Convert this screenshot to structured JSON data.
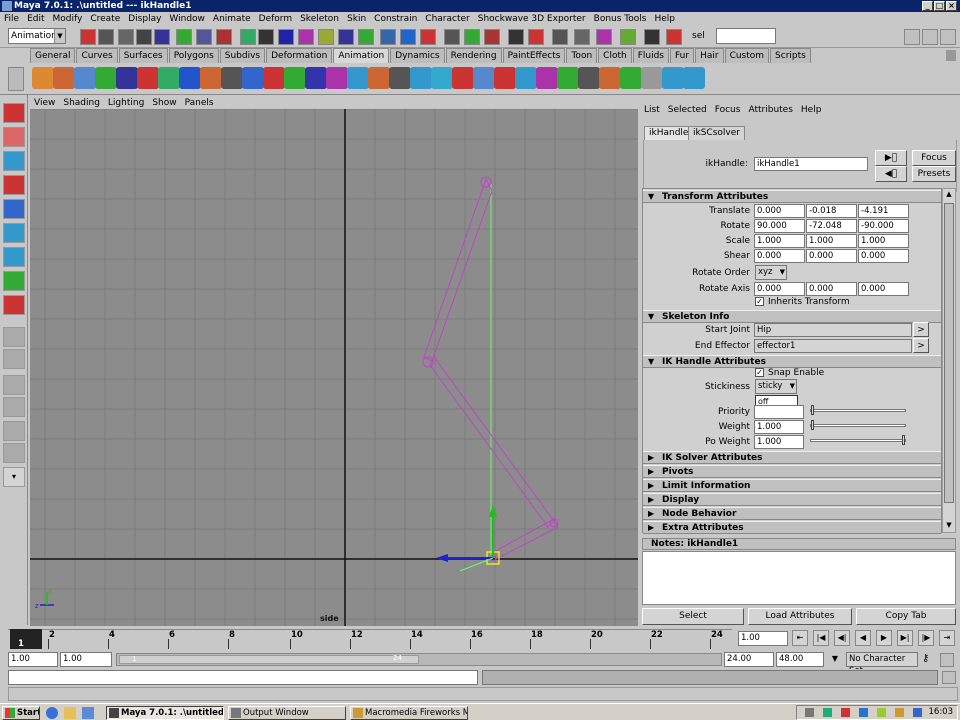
{
  "window": {
    "title": "Maya 7.0.1: .\\untitled  ---  ikHandle1"
  },
  "menubar": [
    "File",
    "Edit",
    "Modify",
    "Create",
    "Display",
    "Window",
    "Animate",
    "Deform",
    "Skeleton",
    "Skin",
    "Constrain",
    "Character",
    "Shockwave 3D Exporter",
    "Bonus Tools",
    "Help"
  ],
  "statusline": {
    "menuset": "Animation",
    "sel_label": "sel"
  },
  "shelf_tabs": [
    {
      "label": "General",
      "active": false
    },
    {
      "label": "Curves",
      "active": false
    },
    {
      "label": "Surfaces",
      "active": false
    },
    {
      "label": "Polygons",
      "active": false
    },
    {
      "label": "Subdivs",
      "active": false
    },
    {
      "label": "Deformation",
      "active": false
    },
    {
      "label": "Animation",
      "active": true
    },
    {
      "label": "Dynamics",
      "active": false
    },
    {
      "label": "Rendering",
      "active": false
    },
    {
      "label": "PaintEffects",
      "active": false
    },
    {
      "label": "Toon",
      "active": false
    },
    {
      "label": "Cloth",
      "active": false
    },
    {
      "label": "Fluids",
      "active": false
    },
    {
      "label": "Fur",
      "active": false
    },
    {
      "label": "Hair",
      "active": false
    },
    {
      "label": "Custom",
      "active": false
    },
    {
      "label": "Scripts",
      "active": false
    }
  ],
  "viewport": {
    "menu": [
      "View",
      "Shading",
      "Lighting",
      "Show",
      "Panels"
    ],
    "camera_label": "side",
    "colors": {
      "background": "#8c8c8c",
      "grid": "#7e7e7e",
      "axis": "#111111",
      "bones": "#c044c8",
      "ik_chain": "#60ff60"
    }
  },
  "attribute_editor": {
    "menu": [
      "List",
      "Selected",
      "Focus",
      "Attributes",
      "Help"
    ],
    "tabs": [
      {
        "label": "ikHandle1",
        "active": true
      },
      {
        "label": "ikSCsolver",
        "active": false
      }
    ],
    "name_label": "ikHandle:",
    "name_value": "ikHandle1",
    "focus_button": "Focus",
    "presets_button": "Presets",
    "transform_header": "Transform Attributes",
    "translate": {
      "label": "Translate",
      "values": [
        "0.000",
        "-0.018",
        "-4.191"
      ]
    },
    "rotate": {
      "label": "Rotate",
      "values": [
        "90.000",
        "-72.048",
        "-90.000"
      ]
    },
    "scale": {
      "label": "Scale",
      "values": [
        "1.000",
        "1.000",
        "1.000"
      ]
    },
    "shear": {
      "label": "Shear",
      "values": [
        "0.000",
        "0.000",
        "0.000"
      ]
    },
    "rotate_order": {
      "label": "Rotate Order",
      "value": "xyz"
    },
    "rotate_axis": {
      "label": "Rotate Axis",
      "values": [
        "0.000",
        "0.000",
        "0.000"
      ]
    },
    "inherits_transform": "Inherits Transform",
    "skeleton_header": "Skeleton Info",
    "start_joint": {
      "label": "Start Joint",
      "value": "Hip"
    },
    "end_effector": {
      "label": "End Effector",
      "value": "effector1"
    },
    "ik_header": "IK Handle Attributes",
    "snap_enable": "Snap Enable",
    "stickiness": {
      "label": "Stickiness",
      "value": "sticky",
      "options": [
        "off",
        "sticky"
      ]
    },
    "priority": {
      "label": "Priority",
      "value": "",
      "slider_fraction": 0.01
    },
    "weight": {
      "label": "Weight",
      "value": "1.000",
      "slider_fraction": 0.01
    },
    "po_weight": {
      "label": "Po Weight",
      "value": "1.000",
      "slider_fraction": 1.0
    },
    "collapsed_sections": [
      "IK Solver Attributes",
      "Pivots",
      "Limit Information",
      "Display",
      "Node Behavior",
      "Extra Attributes"
    ],
    "notes_label": "Notes:  ikHandle1",
    "buttons": {
      "select": "Select",
      "load": "Load Attributes",
      "copy": "Copy Tab"
    }
  },
  "timeline": {
    "ticks": [
      "1",
      "2",
      "4",
      "6",
      "8",
      "10",
      "12",
      "14",
      "16",
      "18",
      "20",
      "22",
      "24"
    ],
    "current_frame": "1.00",
    "range_start": "1.00",
    "range_inner_start": "1.00",
    "range_slider_left": "1",
    "range_slider_right": "24",
    "range_end": "24.00",
    "range_outer_end": "48.00",
    "character_set": "No Character Set"
  },
  "taskbar": {
    "start": "Start",
    "items": [
      {
        "label": "Maya 7.0.1: .\\untitled ...",
        "active": true
      },
      {
        "label": "Output Window",
        "active": false
      },
      {
        "label": "Macromedia Fireworks M...",
        "active": false
      }
    ],
    "clock": "16:03"
  }
}
